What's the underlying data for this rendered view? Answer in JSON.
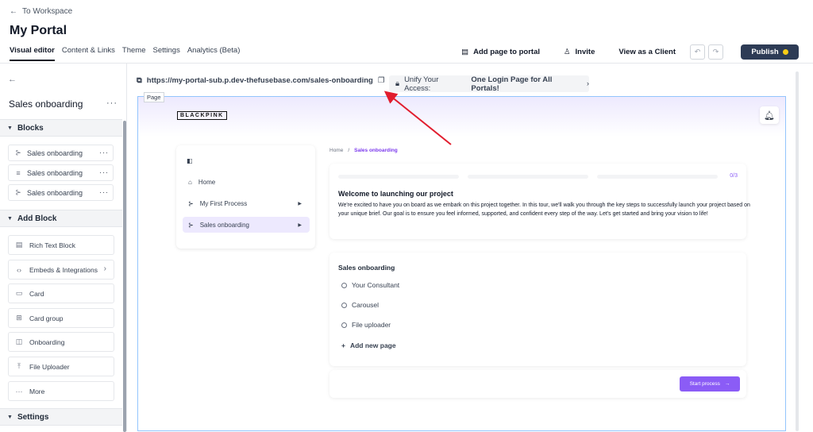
{
  "header": {
    "back_label": "To Workspace",
    "portal_title": "My Portal",
    "tabs": [
      {
        "label": "Visual editor"
      },
      {
        "label": "Content & Links"
      },
      {
        "label": "Theme"
      },
      {
        "label": "Settings"
      },
      {
        "label": "Analytics (Beta)"
      }
    ],
    "add_page_label": "Add page to portal",
    "invite_label": "Invite",
    "view_as_client_label": "View as a Client",
    "publish_label": "Publish"
  },
  "sidebar": {
    "page_title": "Sales onboarding",
    "blocks_heading": "Blocks",
    "blocks": [
      {
        "label": "Sales onboarding",
        "icon": "process-icon"
      },
      {
        "label": "Sales onboarding",
        "icon": "text-lines-icon"
      },
      {
        "label": "Sales onboarding",
        "icon": "process-icon"
      }
    ],
    "add_block_heading": "Add Block",
    "add_blocks": [
      {
        "label": "Rich Text Block",
        "icon": "document-icon"
      },
      {
        "label": "Embeds & Integrations",
        "icon": "code-icon"
      },
      {
        "label": "Card",
        "icon": "card-icon"
      },
      {
        "label": "Card group",
        "icon": "grid-icon"
      },
      {
        "label": "Onboarding",
        "icon": "onboarding-icon"
      },
      {
        "label": "File Uploader",
        "icon": "upload-icon"
      },
      {
        "label": "More",
        "icon": "more-icon"
      }
    ],
    "settings_heading": "Settings"
  },
  "editor": {
    "url": "https://my-portal-sub.p.dev-thefusebase.com/sales-onboarding",
    "unify_prefix": "Unify Your Access:",
    "unify_bold": "One Login Page for All Portals!",
    "page_tag": "Page"
  },
  "preview": {
    "logo_text": "BLACKPINK",
    "nav": [
      {
        "label": "Home"
      },
      {
        "label": "My First Process"
      },
      {
        "label": "Sales onboarding"
      }
    ],
    "breadcrumb": {
      "home": "Home",
      "separator": "/",
      "current": "Sales onboarding"
    },
    "progress_count": "0/3",
    "welcome_title": "Welcome to launching our project",
    "welcome_body": "We're excited to have you on board as we embark on this project together. In this tour, we'll walk you through the key steps to successfully launch your project based on your unique brief. Our goal is to ensure you feel informed, supported, and confident every step of the way. Let's get started and bring your vision to life!",
    "process_title": "Sales onboarding",
    "process_items": [
      {
        "label": "Your Consultant"
      },
      {
        "label": "Carousel"
      },
      {
        "label": "File uploader"
      }
    ],
    "add_page_label": "Add new page",
    "start_button": "Start process"
  },
  "colors": {
    "accent": "#8b5cf6",
    "publish_bg": "#2d3b55",
    "annotation_arrow": "#e11d2e"
  }
}
